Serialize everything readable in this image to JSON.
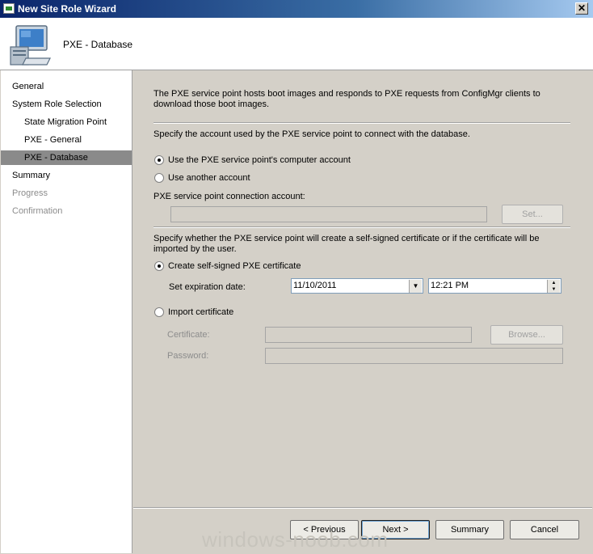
{
  "window": {
    "title": "New Site Role Wizard",
    "close_glyph": "✕"
  },
  "header": {
    "title": "PXE - Database",
    "icon": "computer-icon"
  },
  "sidebar": {
    "items": [
      {
        "label": "General",
        "level": 0,
        "state": "normal"
      },
      {
        "label": "System Role Selection",
        "level": 0,
        "state": "normal"
      },
      {
        "label": "State Migration Point",
        "level": 1,
        "state": "normal"
      },
      {
        "label": "PXE - General",
        "level": 1,
        "state": "normal"
      },
      {
        "label": "PXE - Database",
        "level": 1,
        "state": "selected"
      },
      {
        "label": "Summary",
        "level": 0,
        "state": "normal"
      },
      {
        "label": "Progress",
        "level": 0,
        "state": "disabled"
      },
      {
        "label": "Confirmation",
        "level": 0,
        "state": "disabled"
      }
    ]
  },
  "main": {
    "intro_line1": "The PXE service point hosts boot images and responds to PXE requests from ConfigMgr clients to",
    "intro_line2": "download those boot images.",
    "account_prompt": "Specify the account used by the PXE service point to connect with the database.",
    "radio_computer_account": "Use the PXE service point's computer account",
    "radio_another_account": "Use another account",
    "connection_account_label": "PXE service point connection account:",
    "connection_account_value": "",
    "set_button": "Set...",
    "cert_prompt_line1": "Specify whether the PXE service point will create a self-signed certificate or if the certificate will be",
    "cert_prompt_line2": "imported by the user.",
    "radio_self_signed": "Create self-signed PXE certificate",
    "expiration_label": "Set expiration date:",
    "expiration_date": "11/10/2011",
    "expiration_time": "12:21 PM",
    "radio_import": "Import certificate",
    "certificate_label": "Certificate:",
    "certificate_value": "",
    "browse_button": "Browse...",
    "password_label": "Password:",
    "password_value": ""
  },
  "footer": {
    "previous": "< Previous",
    "next": "Next >",
    "summary": "Summary",
    "cancel": "Cancel"
  },
  "watermark": "windows-noob.com"
}
